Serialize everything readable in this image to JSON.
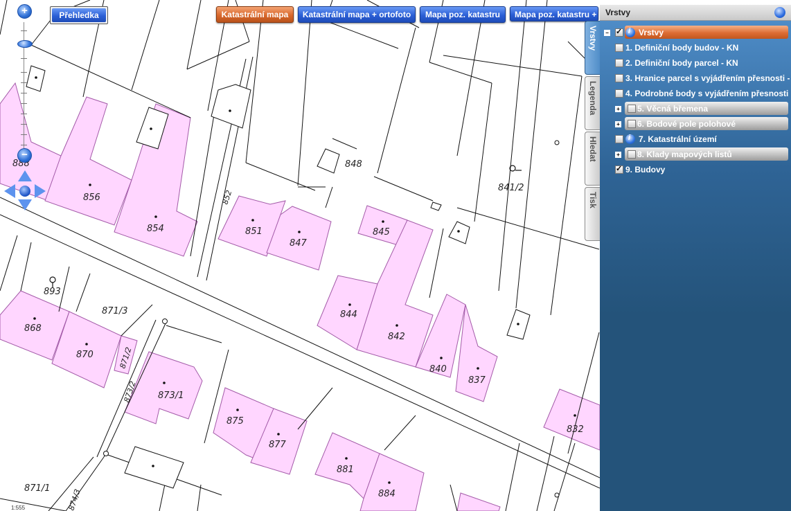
{
  "toolbar": {
    "overview_label": "Přehledka",
    "buttons": [
      {
        "label": "Katastrální mapa",
        "active": true
      },
      {
        "label": "Katastrální mapa + ortofoto",
        "active": false
      },
      {
        "label": "Mapa poz. katastru",
        "active": false
      },
      {
        "label": "Mapa poz. katastru +",
        "active": false
      }
    ]
  },
  "zoom": {
    "in": "+",
    "out": "−"
  },
  "map": {
    "scale_text": "1:555",
    "parcels": [
      "888",
      "856",
      "854",
      "851",
      "847",
      "845",
      "848",
      "841/2",
      "844",
      "842",
      "840",
      "837",
      "893",
      "871/3",
      "868",
      "870",
      "871/2",
      "873/2",
      "873/1",
      "875",
      "877",
      "881",
      "884",
      "832",
      "871/1",
      "874/3",
      "852"
    ]
  },
  "panel": {
    "title": "Vrstvy",
    "root_label": "Vrstvy",
    "layers": [
      {
        "label": "1. Definiční body budov - KN",
        "checked": false
      },
      {
        "label": "2. Definiční body parcel - KN",
        "checked": false
      },
      {
        "label": "3. Hranice parcel s vyjádřením přesnosti -",
        "checked": false
      },
      {
        "label": "4. Podrobné body s vyjádřením přesnosti -",
        "checked": false
      },
      {
        "label": "5. Věcná břemena",
        "checked": false
      },
      {
        "label": "6. Bodové pole polohové",
        "checked": false
      },
      {
        "label": "7. Katastrální území",
        "checked": false
      },
      {
        "label": "8. Klady mapových listů",
        "checked": false
      },
      {
        "label": "9. Budovy",
        "checked": true
      }
    ]
  },
  "tabs": [
    {
      "label": "Vrstvy",
      "active": true
    },
    {
      "label": "Legenda",
      "active": false
    },
    {
      "label": "Hledat",
      "active": false
    },
    {
      "label": "Tisk",
      "active": false
    }
  ],
  "colors": {
    "building_fill": "#ffd6ff",
    "building_stroke": "#a35aa8",
    "panel_bg": "#24537a",
    "accent_orange": "#d9682c"
  }
}
